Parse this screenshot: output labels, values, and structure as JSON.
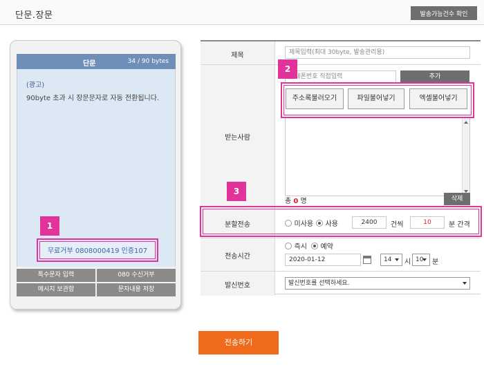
{
  "header": {
    "title": "단문.장문",
    "check_button": "발송가능건수 확인"
  },
  "phone": {
    "type_label": "단문",
    "bytes": "34 / 90 bytes",
    "ad_label": "(광고)",
    "message": "90byte 초과 시 장문문자로 자동 전환됩니다.",
    "optout_text": "무료거부 0808000419 인증107",
    "buttons": [
      "특수문자 입력",
      "080 수신거부",
      "메시지 보관함",
      "문자내용 저장"
    ]
  },
  "markers": {
    "m1": "1",
    "m2": "2",
    "m3": "3"
  },
  "form": {
    "subject_label": "제목",
    "subject_placeholder": "제목입력(최대 30byte, 발송관리용)",
    "recipient_label": "받는사람",
    "phone_input_placeholder": "휴대폰번호 직접입력",
    "add_button": "추가",
    "load_buttons": [
      "주소록불러오기",
      "파일불어넣기",
      "엑셀불어넣기"
    ],
    "total_prefix": "총",
    "total_count": "0",
    "total_suffix": "명",
    "delete_button": "삭제",
    "split_label": "분할전송",
    "split_off": "미사용",
    "split_on": "사용",
    "split_count": "2400",
    "split_count_unit": "건씩",
    "split_interval": "10",
    "split_interval_unit": "분 간격",
    "send_time_label": "전송시간",
    "send_now": "즉시",
    "send_reserve": "예약",
    "date": "2020-01-12",
    "hour": "14",
    "hour_unit": "시",
    "minute": "10",
    "minute_unit": "분",
    "sender_label": "발신번호",
    "sender_placeholder": "발신번호를 선택하세요."
  },
  "send_button": "전송하기",
  "colors": {
    "accent": "#e2339a",
    "send": "#ef6a1a",
    "phone_head": "#6f8fb8",
    "count_red": "#e02020"
  }
}
